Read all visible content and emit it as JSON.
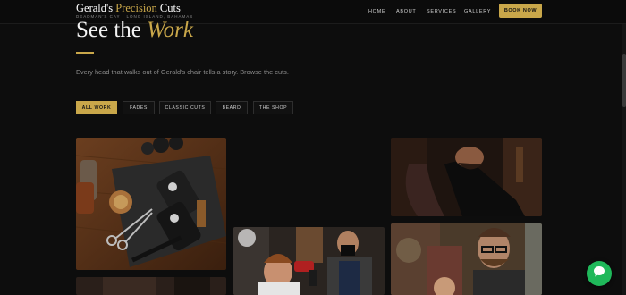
{
  "brand": {
    "name_part1": "Gerald's ",
    "name_accent": "Precision",
    "name_part2": " Cuts",
    "subtitle": "DEADMAN'S CAY · LONG ISLAND, BAHAMAS"
  },
  "nav": {
    "items": [
      {
        "label": "HOME"
      },
      {
        "label": "ABOUT"
      },
      {
        "label": "SERVICES"
      },
      {
        "label": "GALLERY"
      }
    ],
    "cta_label": "BOOK NOW"
  },
  "section": {
    "heading_prefix": "See the ",
    "heading_accent": "Work",
    "intro": "Every head that walks out of Gerald's chair tells a story. Browse the cuts."
  },
  "filters": {
    "items": [
      {
        "label": "ALL WORK",
        "active": true
      },
      {
        "label": "FADES",
        "active": false
      },
      {
        "label": "CLASSIC CUTS",
        "active": false
      },
      {
        "label": "BEARD",
        "active": false
      },
      {
        "label": "THE SHOP",
        "active": false
      }
    ]
  },
  "gallery": {
    "tiles": [
      {
        "subject": "barber tools flatlay"
      },
      {
        "subject": "beard trim client"
      },
      {
        "subject": "haircut with hair dryer"
      },
      {
        "subject": "barber with glasses"
      },
      {
        "subject": "bottom tile"
      }
    ]
  },
  "colors": {
    "accent": "#c9a74a",
    "background": "#0d0d0d",
    "chat_button": "#1fb85a"
  },
  "icons": {
    "chat": "chat-bubble-icon"
  }
}
